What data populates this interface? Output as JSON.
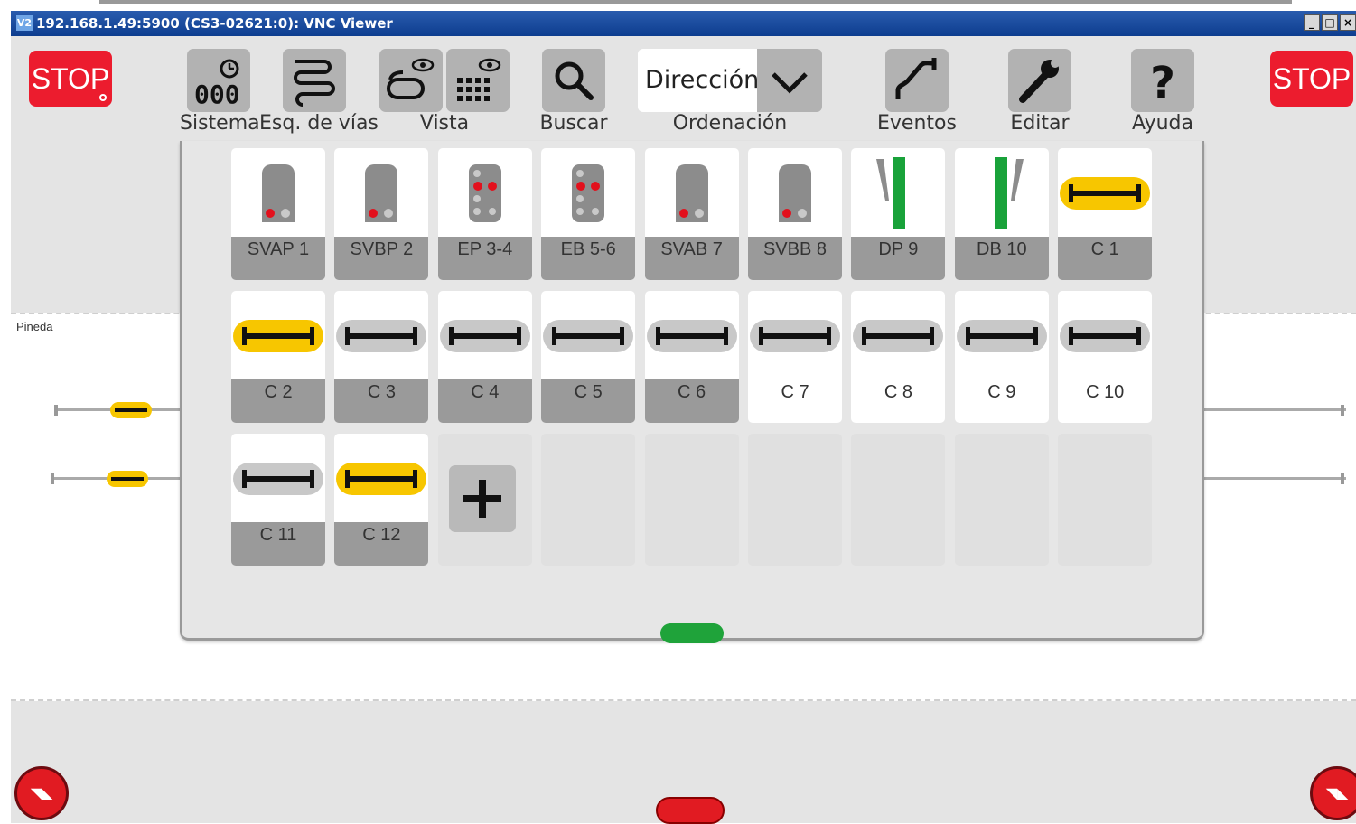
{
  "window": {
    "title": "192.168.1.49:5900 (CS3-02621:0): VNC Viewer",
    "vnc_icon": "V2"
  },
  "colors": {
    "stop_red": "#ec1c2e",
    "active_yellow": "#f7c600",
    "green_handle": "#1fa33a",
    "tool_gray": "#b2b2b2"
  },
  "stop_left": "STOP",
  "stop_right": "STOP",
  "toolbar": {
    "sistema": "Sistema",
    "esq_vias": "Esq. de vías",
    "vista": "Vista",
    "buscar": "Buscar",
    "ordenacion": "Ordenación",
    "ordenacion_value": "Dirección",
    "eventos": "Eventos",
    "editar": "Editar",
    "ayuda": "Ayuda"
  },
  "layout": {
    "name": "Pineda"
  },
  "articles": [
    {
      "label": "SVAP 1",
      "icon": "signal-2",
      "active": true
    },
    {
      "label": "SVBP 2",
      "icon": "signal-2",
      "active": true
    },
    {
      "label": "EP 3-4",
      "icon": "signal-multi",
      "active": true
    },
    {
      "label": "EB 5-6",
      "icon": "signal-multi",
      "active": true
    },
    {
      "label": "SVAB 7",
      "icon": "signal-2",
      "active": true
    },
    {
      "label": "SVBB 8",
      "icon": "signal-2",
      "active": true
    },
    {
      "label": "DP 9",
      "icon": "turnout-left",
      "active": true
    },
    {
      "label": "DB 10",
      "icon": "turnout-right",
      "active": true
    },
    {
      "label": "C 1",
      "icon": "uncoupler-yellow",
      "active": true
    },
    {
      "label": "C 2",
      "icon": "uncoupler-yellow",
      "active": true
    },
    {
      "label": "C 3",
      "icon": "uncoupler-gray",
      "active": true
    },
    {
      "label": "C 4",
      "icon": "uncoupler-gray",
      "active": true
    },
    {
      "label": "C 5",
      "icon": "uncoupler-gray",
      "active": true
    },
    {
      "label": "C 6",
      "icon": "uncoupler-gray",
      "active": true
    },
    {
      "label": "C 7",
      "icon": "uncoupler-gray",
      "active": false
    },
    {
      "label": "C 8",
      "icon": "uncoupler-gray",
      "active": false
    },
    {
      "label": "C 9",
      "icon": "uncoupler-gray",
      "active": false
    },
    {
      "label": "C 10",
      "icon": "uncoupler-gray",
      "active": false
    },
    {
      "label": "C 11",
      "icon": "uncoupler-gray",
      "active": true
    },
    {
      "label": "C 12",
      "icon": "uncoupler-yellow",
      "active": true
    }
  ]
}
